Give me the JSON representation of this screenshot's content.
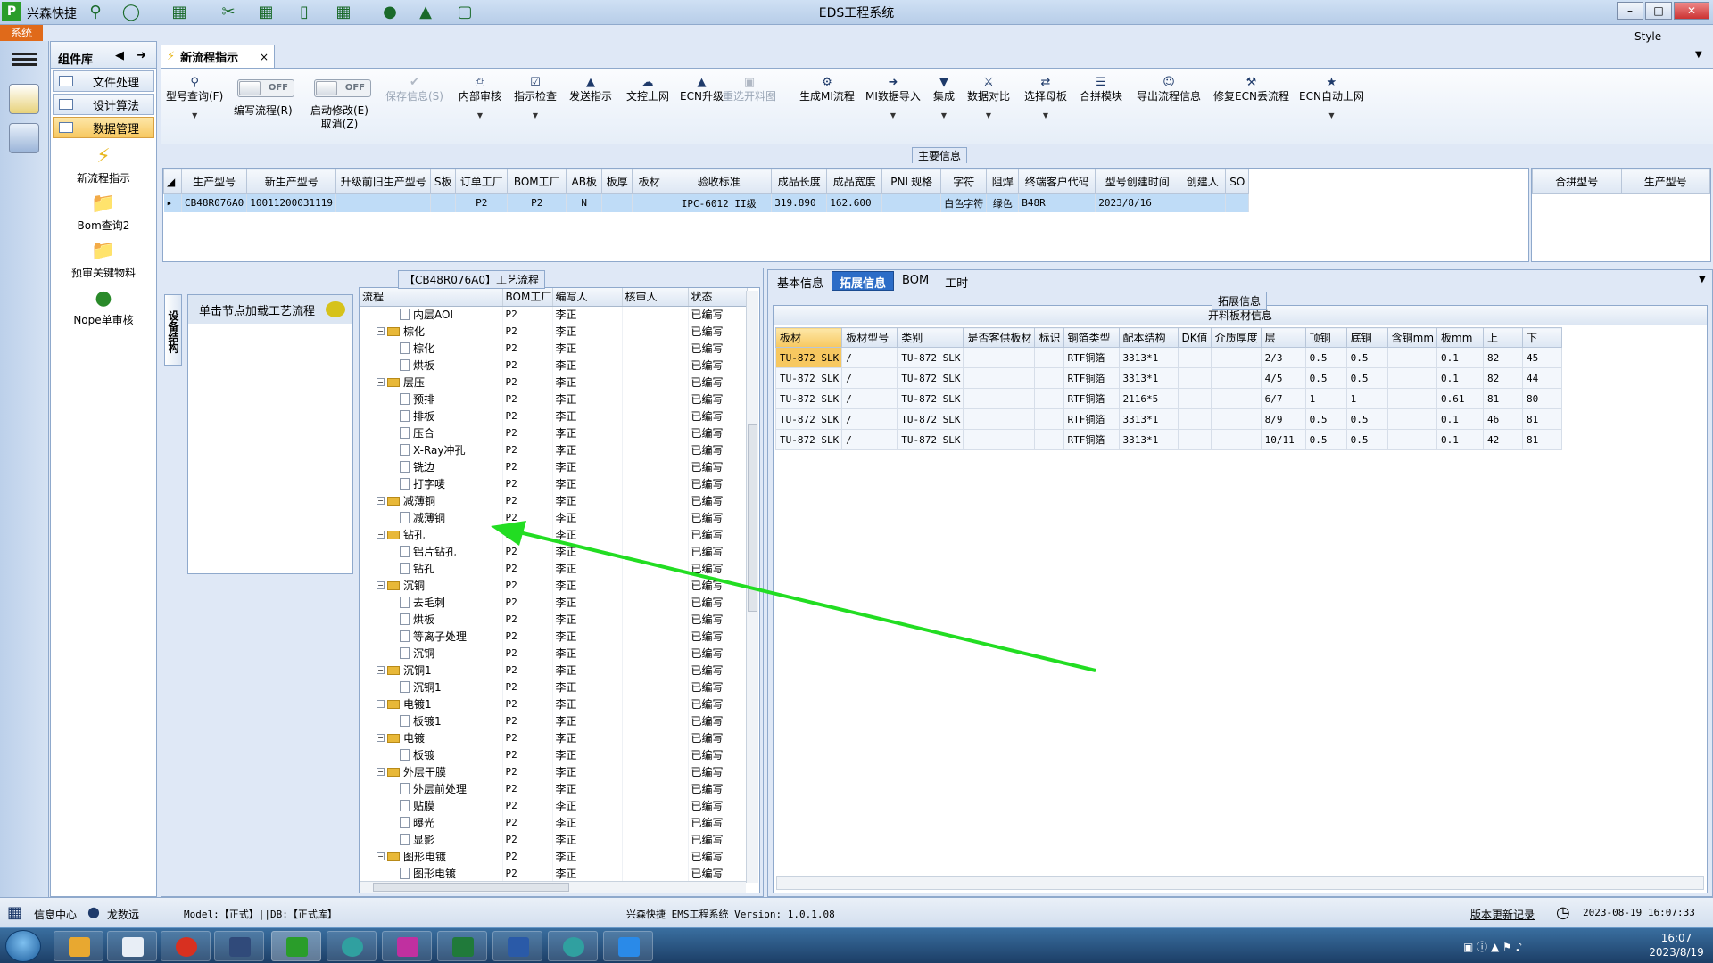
{
  "titlebar": {
    "app_name": "兴森快捷",
    "window_title": "EDS工程系统"
  },
  "systab": "系统",
  "style_label": "Style",
  "component_panel": {
    "title": "组件库",
    "categories": [
      "文件处理",
      "设计算法",
      "数据管理"
    ],
    "nav_items": [
      "新流程指示",
      "Bom查询2",
      "预审关键物料",
      "Nope单审核"
    ]
  },
  "doc_tab": {
    "label": "新流程指示",
    "close": "×"
  },
  "toolbar": {
    "model_query": "型号查询(F)",
    "edit_flow": "编写流程(R)",
    "toggle_off": "OFF",
    "start_modify": "启动修改(E)",
    "cancel": "取消(Z)",
    "save_info": "保存信息(S)",
    "internal_review": "内部审核",
    "instruction_check": "指示检查",
    "send_instruction": "发送指示",
    "upload_doc": "文控上网",
    "ecn_upgrade": "ECN升级",
    "reselect_cut": "重选开料图",
    "gen_mi_flow": "生成MI流程",
    "mi_import": "MI数据导入",
    "integrate": "集成",
    "data_compare": "数据对比",
    "select_mother": "选择母板",
    "combine_module": "合拼模块",
    "export_flow": "导出流程信息",
    "fix_ecn": "修复ECN丢流程",
    "ecn_auto": "ECN自动上网"
  },
  "main_info": {
    "label": "主要信息",
    "columns": [
      "生产型号",
      "新生产型号",
      "升级前旧生产型号",
      "S板",
      "订单工厂",
      "BOM工厂",
      "AB板",
      "板厚",
      "板材",
      "验收标准",
      "成品长度",
      "成品宽度",
      "PNL规格",
      "字符",
      "阻焊",
      "终端客户代码",
      "型号创建时间",
      "创建人",
      "SO"
    ],
    "row": [
      "CB48R076A0",
      "10011200031119",
      "",
      "",
      "P2",
      "P2",
      "N",
      "",
      "",
      "IPC-6012 II级",
      "319.890",
      "162.600",
      "",
      "白色字符",
      "绿色",
      "B48R",
      "2023/8/16",
      "",
      ""
    ]
  },
  "side_grid": {
    "columns": [
      "合拼型号",
      "生产型号"
    ]
  },
  "process": {
    "title": "【CB48R076A0】工艺流程",
    "vertical_tab": "设备结构",
    "load_hint": "单击节点加载工艺流程",
    "columns": [
      "流程",
      "BOM工厂",
      "编写人",
      "核审人",
      "状态"
    ],
    "rows": [
      {
        "name": "内层AOI",
        "level": 2,
        "type": "doc",
        "fac": "P2",
        "writer": "李正",
        "status": "已编写"
      },
      {
        "name": "棕化",
        "level": 1,
        "type": "folder",
        "fac": "P2",
        "writer": "李正",
        "status": "已编写"
      },
      {
        "name": "棕化",
        "level": 2,
        "type": "doc",
        "fac": "P2",
        "writer": "李正",
        "status": "已编写"
      },
      {
        "name": "烘板",
        "level": 2,
        "type": "doc",
        "fac": "P2",
        "writer": "李正",
        "status": "已编写"
      },
      {
        "name": "层压",
        "level": 1,
        "type": "folder",
        "fac": "P2",
        "writer": "李正",
        "status": "已编写"
      },
      {
        "name": "预排",
        "level": 2,
        "type": "doc",
        "fac": "P2",
        "writer": "李正",
        "status": "已编写"
      },
      {
        "name": "排板",
        "level": 2,
        "type": "doc",
        "fac": "P2",
        "writer": "李正",
        "status": "已编写"
      },
      {
        "name": "压合",
        "level": 2,
        "type": "doc",
        "fac": "P2",
        "writer": "李正",
        "status": "已编写"
      },
      {
        "name": "X-Ray冲孔",
        "level": 2,
        "type": "doc",
        "fac": "P2",
        "writer": "李正",
        "status": "已编写"
      },
      {
        "name": "铣边",
        "level": 2,
        "type": "doc",
        "fac": "P2",
        "writer": "李正",
        "status": "已编写"
      },
      {
        "name": "打字唛",
        "level": 2,
        "type": "doc",
        "fac": "P2",
        "writer": "李正",
        "status": "已编写"
      },
      {
        "name": "减薄铜",
        "level": 1,
        "type": "folder",
        "fac": "P2",
        "writer": "李正",
        "status": "已编写"
      },
      {
        "name": "减薄铜",
        "level": 2,
        "type": "doc",
        "fac": "P2",
        "writer": "李正",
        "status": "已编写"
      },
      {
        "name": "钻孔",
        "level": 1,
        "type": "folder",
        "fac": "P2",
        "writer": "李正",
        "status": "已编写"
      },
      {
        "name": "铝片钻孔",
        "level": 2,
        "type": "doc",
        "fac": "P2",
        "writer": "李正",
        "status": "已编写"
      },
      {
        "name": "钻孔",
        "level": 2,
        "type": "doc",
        "fac": "P2",
        "writer": "李正",
        "status": "已编写"
      },
      {
        "name": "沉铜",
        "level": 1,
        "type": "folder",
        "fac": "P2",
        "writer": "李正",
        "status": "已编写"
      },
      {
        "name": "去毛刺",
        "level": 2,
        "type": "doc",
        "fac": "P2",
        "writer": "李正",
        "status": "已编写"
      },
      {
        "name": "烘板",
        "level": 2,
        "type": "doc",
        "fac": "P2",
        "writer": "李正",
        "status": "已编写"
      },
      {
        "name": "等离子处理",
        "level": 2,
        "type": "doc",
        "fac": "P2",
        "writer": "李正",
        "status": "已编写"
      },
      {
        "name": "沉铜",
        "level": 2,
        "type": "doc",
        "fac": "P2",
        "writer": "李正",
        "status": "已编写"
      },
      {
        "name": "沉铜1",
        "level": 1,
        "type": "folder",
        "fac": "P2",
        "writer": "李正",
        "status": "已编写"
      },
      {
        "name": "沉铜1",
        "level": 2,
        "type": "doc",
        "fac": "P2",
        "writer": "李正",
        "status": "已编写"
      },
      {
        "name": "电镀1",
        "level": 1,
        "type": "folder",
        "fac": "P2",
        "writer": "李正",
        "status": "已编写"
      },
      {
        "name": "板镀1",
        "level": 2,
        "type": "doc",
        "fac": "P2",
        "writer": "李正",
        "status": "已编写"
      },
      {
        "name": "电镀",
        "level": 1,
        "type": "folder",
        "fac": "P2",
        "writer": "李正",
        "status": "已编写"
      },
      {
        "name": "板镀",
        "level": 2,
        "type": "doc",
        "fac": "P2",
        "writer": "李正",
        "status": "已编写"
      },
      {
        "name": "外层干膜",
        "level": 1,
        "type": "folder",
        "fac": "P2",
        "writer": "李正",
        "status": "已编写"
      },
      {
        "name": "外层前处理",
        "level": 2,
        "type": "doc",
        "fac": "P2",
        "writer": "李正",
        "status": "已编写"
      },
      {
        "name": "贴膜",
        "level": 2,
        "type": "doc",
        "fac": "P2",
        "writer": "李正",
        "status": "已编写"
      },
      {
        "name": "曝光",
        "level": 2,
        "type": "doc",
        "fac": "P2",
        "writer": "李正",
        "status": "已编写"
      },
      {
        "name": "显影",
        "level": 2,
        "type": "doc",
        "fac": "P2",
        "writer": "李正",
        "status": "已编写"
      },
      {
        "name": "图形电镀",
        "level": 1,
        "type": "folder",
        "fac": "P2",
        "writer": "李正",
        "status": "已编写"
      },
      {
        "name": "图形电镀",
        "level": 2,
        "type": "doc",
        "fac": "P2",
        "writer": "李正",
        "status": "已编写"
      }
    ]
  },
  "right_tabs": [
    "基本信息",
    "拓展信息",
    "BOM",
    "工时"
  ],
  "extended": {
    "label": "拓展信息",
    "caption": "开料板材信息",
    "columns": [
      "板材",
      "板材型号",
      "类别",
      "是否客供板材",
      "标识",
      "铜箔类型",
      "配本结构",
      "DK值",
      "介质厚度",
      "层",
      "顶铜",
      "底铜",
      "含铜mm",
      "板mm",
      "上",
      "下"
    ],
    "rows": [
      [
        "TU-872 SLK",
        "/",
        "TU-872 SLK",
        "",
        "",
        "RTF铜箔",
        "3313*1",
        "",
        "",
        "2/3",
        "0.5",
        "0.5",
        "",
        "0.1",
        "82",
        "45"
      ],
      [
        "TU-872 SLK",
        "/",
        "TU-872 SLK",
        "",
        "",
        "RTF铜箔",
        "3313*1",
        "",
        "",
        "4/5",
        "0.5",
        "0.5",
        "",
        "0.1",
        "82",
        "44"
      ],
      [
        "TU-872 SLK",
        "/",
        "TU-872 SLK",
        "",
        "",
        "RTF铜箔",
        "2116*5",
        "",
        "",
        "6/7",
        "1",
        "1",
        "",
        "0.61",
        "81",
        "80"
      ],
      [
        "TU-872 SLK",
        "/",
        "TU-872 SLK",
        "",
        "",
        "RTF铜箔",
        "3313*1",
        "",
        "",
        "8/9",
        "0.5",
        "0.5",
        "",
        "0.1",
        "46",
        "81"
      ],
      [
        "TU-872 SLK",
        "/",
        "TU-872 SLK",
        "",
        "",
        "RTF铜箔",
        "3313*1",
        "",
        "",
        "10/11",
        "0.5",
        "0.5",
        "",
        "0.1",
        "42",
        "81"
      ]
    ]
  },
  "status": {
    "info_center": "信息中心",
    "user": "龙数远",
    "model_db": "Model:【正式】||DB:【正式库】",
    "version": "兴森快捷 EMS工程系统 Version: 1.0.1.08",
    "update_log": "版本更新记录",
    "datetime": "2023-08-19 16:07:33"
  },
  "taskbar": {
    "time": "16:07",
    "date": "2023/8/19"
  },
  "colors": {
    "accent": "#2b6cc7",
    "highlight": "#f7c860",
    "selection": "#bfdcf7",
    "arrow": "#22dd22"
  }
}
